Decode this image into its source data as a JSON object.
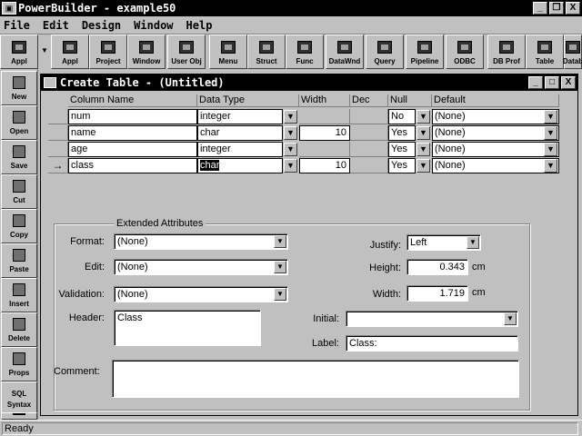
{
  "app": {
    "title": "PowerBuilder - example50"
  },
  "window_controls": {
    "minimize": "_",
    "restore": "❐",
    "close": "X"
  },
  "menu": [
    "File",
    "Edit",
    "Design",
    "Window",
    "Help"
  ],
  "toolbar": {
    "items": [
      {
        "label": "Appl",
        "icon": "application-icon"
      },
      {
        "label": "Project",
        "icon": "project-icon"
      },
      {
        "label": "Window",
        "icon": "window-icon"
      },
      {
        "label": "User Obj",
        "icon": "user-object-icon"
      },
      {
        "label": "Menu",
        "icon": "menu-icon"
      },
      {
        "label": "Struct",
        "icon": "structure-icon"
      },
      {
        "label": "Func",
        "icon": "function-icon"
      },
      {
        "label": "DataWnd",
        "icon": "datawindow-icon"
      },
      {
        "label": "Query",
        "icon": "query-icon"
      },
      {
        "label": "Pipeline",
        "icon": "pipeline-icon"
      },
      {
        "label": "ODBC",
        "icon": "odbc-icon"
      },
      {
        "label": "DB Prof",
        "icon": "db-profile-icon"
      },
      {
        "label": "Table",
        "icon": "table-icon"
      },
      {
        "label": "Datab",
        "icon": "database-icon"
      }
    ],
    "dropdown_label": "Appl"
  },
  "sidebar": {
    "items": [
      {
        "label": "New",
        "icon": "new-icon"
      },
      {
        "label": "Open",
        "icon": "open-icon"
      },
      {
        "label": "Save",
        "icon": "save-icon"
      },
      {
        "label": "Cut",
        "icon": "cut-icon"
      },
      {
        "label": "Copy",
        "icon": "copy-icon"
      },
      {
        "label": "Paste",
        "icon": "paste-icon"
      },
      {
        "label": "Insert",
        "icon": "insert-icon"
      },
      {
        "label": "Delete",
        "icon": "delete-icon"
      },
      {
        "label": "Props",
        "icon": "properties-icon"
      },
      {
        "label": "Syntax",
        "icon": "sql-syntax-icon",
        "top_label": "SQL"
      },
      {
        "label": "",
        "icon": "more-icon"
      }
    ]
  },
  "child_window": {
    "title": "Create Table - (Untitled)"
  },
  "grid": {
    "headers": [
      "Column Name",
      "Data Type",
      "Width",
      "Dec",
      "Null",
      "Default"
    ],
    "rows": [
      {
        "name": "num",
        "type": "integer",
        "width": "",
        "dec": "",
        "null": "No",
        "default": "(None)",
        "current": false
      },
      {
        "name": "name",
        "type": "char",
        "width": "10",
        "dec": "",
        "null": "Yes",
        "default": "(None)",
        "current": false
      },
      {
        "name": "age",
        "type": "integer",
        "width": "",
        "dec": "",
        "null": "Yes",
        "default": "(None)",
        "current": false
      },
      {
        "name": "class",
        "type": "char",
        "width": "10",
        "dec": "",
        "null": "Yes",
        "default": "(None)",
        "current": true
      }
    ],
    "current_marker": "→"
  },
  "extended": {
    "legend": "Extended Attributes",
    "format_label": "Format:",
    "format_value": "(None)",
    "edit_label": "Edit:",
    "edit_value": "(None)",
    "validation_label": "Validation:",
    "validation_value": "(None)",
    "header_label": "Header:",
    "header_value": "Class",
    "comment_label": "Comment:",
    "comment_value": "",
    "justify_label": "Justify:",
    "justify_value": "Left",
    "height_label": "Height:",
    "height_value": "0.343",
    "height_unit": "cm",
    "width_label": "Width:",
    "width_value": "1.719",
    "width_unit": "cm",
    "initial_label": "Initial:",
    "initial_value": "",
    "label_label": "Label:",
    "label_value": "Class:"
  },
  "status": {
    "text": "Ready"
  }
}
